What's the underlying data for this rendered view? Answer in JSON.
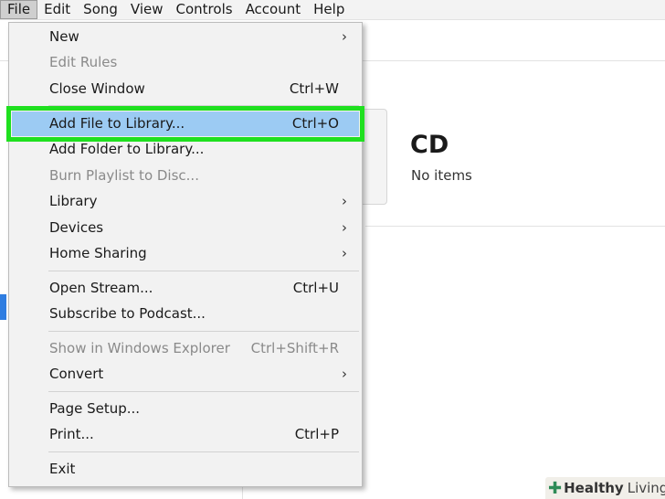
{
  "menubar": {
    "items": [
      "File",
      "Edit",
      "Song",
      "View",
      "Controls",
      "Account",
      "Help"
    ]
  },
  "background": {
    "cd_title": "CD",
    "cd_subtitle": "No items"
  },
  "file_menu": {
    "items": [
      {
        "label": "New",
        "shortcut": "",
        "submenu": true,
        "enabled": true
      },
      {
        "label": "Edit Rules",
        "shortcut": "",
        "submenu": false,
        "enabled": false
      },
      {
        "label": "Close Window",
        "shortcut": "Ctrl+W",
        "submenu": false,
        "enabled": true
      },
      {
        "label": "Add File to Library...",
        "shortcut": "Ctrl+O",
        "submenu": false,
        "enabled": true,
        "highlighted": true
      },
      {
        "label": "Add Folder to Library...",
        "shortcut": "",
        "submenu": false,
        "enabled": true
      },
      {
        "label": "Burn Playlist to Disc...",
        "shortcut": "",
        "submenu": false,
        "enabled": false
      },
      {
        "label": "Library",
        "shortcut": "",
        "submenu": true,
        "enabled": true
      },
      {
        "label": "Devices",
        "shortcut": "",
        "submenu": true,
        "enabled": true
      },
      {
        "label": "Home Sharing",
        "shortcut": "",
        "submenu": true,
        "enabled": true
      },
      {
        "label": "Open Stream...",
        "shortcut": "Ctrl+U",
        "submenu": false,
        "enabled": true
      },
      {
        "label": "Subscribe to Podcast...",
        "shortcut": "",
        "submenu": false,
        "enabled": true
      },
      {
        "label": "Show in Windows Explorer",
        "shortcut": "Ctrl+Shift+R",
        "submenu": false,
        "enabled": false
      },
      {
        "label": "Convert",
        "shortcut": "",
        "submenu": true,
        "enabled": true
      },
      {
        "label": "Page Setup...",
        "shortcut": "",
        "submenu": false,
        "enabled": true
      },
      {
        "label": "Print...",
        "shortcut": "Ctrl+P",
        "submenu": false,
        "enabled": true
      },
      {
        "label": "Exit",
        "shortcut": "",
        "submenu": false,
        "enabled": true
      }
    ],
    "submenu_arrow": "›"
  },
  "watermark": {
    "word1": "Healthy",
    "word2": "Living",
    "icon": "plus-icon"
  },
  "colors": {
    "highlight": "#9ccbf3",
    "highlight_outline": "#1fe01f"
  }
}
